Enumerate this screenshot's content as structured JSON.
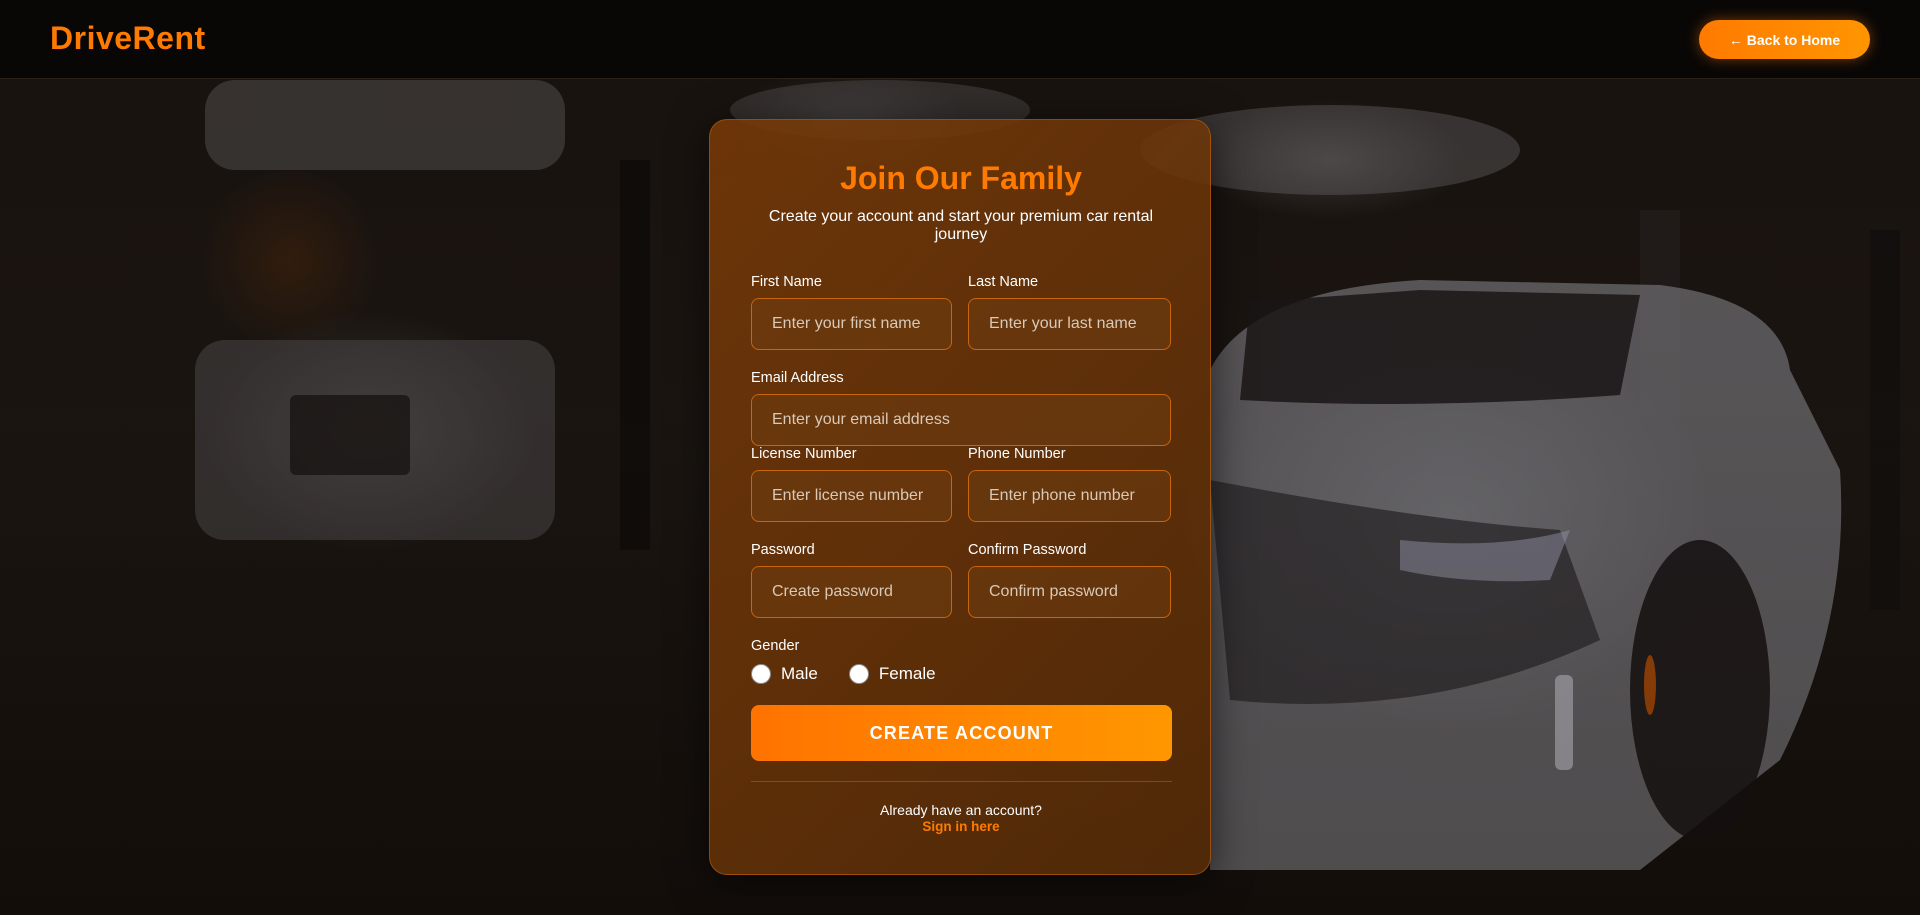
{
  "header": {
    "logo": "DriveRent",
    "back_button": "← Back to Home"
  },
  "form": {
    "title": "Join Our Family",
    "subtitle": "Create your account and start your premium car rental journey",
    "first_name": {
      "label": "First Name",
      "placeholder": "Enter your first name",
      "value": ""
    },
    "last_name": {
      "label": "Last Name",
      "placeholder": "Enter your last name",
      "value": ""
    },
    "email": {
      "label": "Email Address",
      "placeholder": "Enter your email address",
      "value": ""
    },
    "license": {
      "label": "License Number",
      "placeholder": "Enter license number",
      "value": ""
    },
    "phone": {
      "label": "Phone Number",
      "placeholder": "Enter phone number",
      "value": ""
    },
    "password": {
      "label": "Password",
      "placeholder": "Create password",
      "value": ""
    },
    "confirm_password": {
      "label": "Confirm Password",
      "placeholder": "Confirm password",
      "value": ""
    },
    "gender": {
      "label": "Gender",
      "options": [
        "Male",
        "Female"
      ],
      "selected": null
    },
    "submit": "CREATE ACCOUNT",
    "already_text": "Already have an account?",
    "signin_link": "Sign in here"
  },
  "colors": {
    "accent": "#ff7a00",
    "card": "#6e3608",
    "background": "#1a1512"
  }
}
